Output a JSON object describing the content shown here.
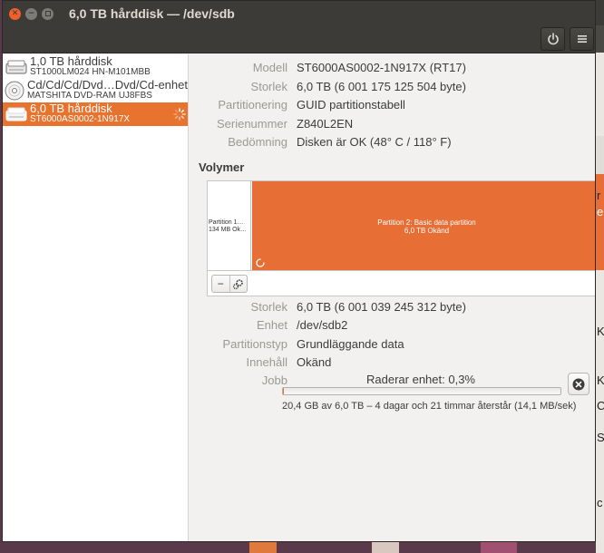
{
  "window": {
    "title": "6,0 TB hårddisk — /dev/sdb"
  },
  "sidebar": {
    "drives": [
      {
        "name": "1,0 TB hårddisk",
        "model": "ST1000LM024 HN-M101MBB",
        "icon": "harddisk-icon",
        "selected": false
      },
      {
        "name": "Cd/Cd/Cd/Dvd…Dvd/Cd-enhet",
        "model": "MATSHITA DVD-RAM UJ8FBS",
        "icon": "optical-disc-icon",
        "selected": false
      },
      {
        "name": "6,0 TB hårddisk",
        "model": "ST6000AS0002-1N917X",
        "icon": "harddisk-icon",
        "selected": true
      }
    ]
  },
  "disk": {
    "model_label": "Modell",
    "model": "ST6000AS0002-1N917X (RT17)",
    "size_label": "Storlek",
    "size": "6,0 TB (6 001 175 125 504 byte)",
    "partitioning_label": "Partitionering",
    "partitioning": "GUID partitionstabell",
    "serial_label": "Serienummer",
    "serial": "Z840L2EN",
    "assessment_label": "Bedömning",
    "assessment": "Disken är OK (48° C / 118° F)"
  },
  "volumes": {
    "heading": "Volymer",
    "partition1": {
      "line1": "Partition 1…",
      "line2": "134 MB Ok…"
    },
    "partition2": {
      "line1": "Partition 2: Basic data partition",
      "line2": "6,0 TB Okänd"
    },
    "remove_symbol": "−",
    "settings_icon": "gears-icon"
  },
  "partition": {
    "size_label": "Storlek",
    "size": "6,0 TB (6 001 039 245 312 byte)",
    "device_label": "Enhet",
    "device": "/dev/sdb2",
    "type_label": "Partitionstyp",
    "type": "Grundläggande data",
    "contents_label": "Innehåll",
    "contents": "Okänd",
    "job_label": "Jobb"
  },
  "job": {
    "title": "Raderar enhet: 0,3%",
    "progress": 0.003,
    "detail": "20,4 GB av 6,0 TB – 4 dagar och 21 timmar återstår (14,1 MB/sek)"
  },
  "colors": {
    "accent": "#e76f36",
    "titlebar": "#3c3b37",
    "close": "#f0602b"
  }
}
